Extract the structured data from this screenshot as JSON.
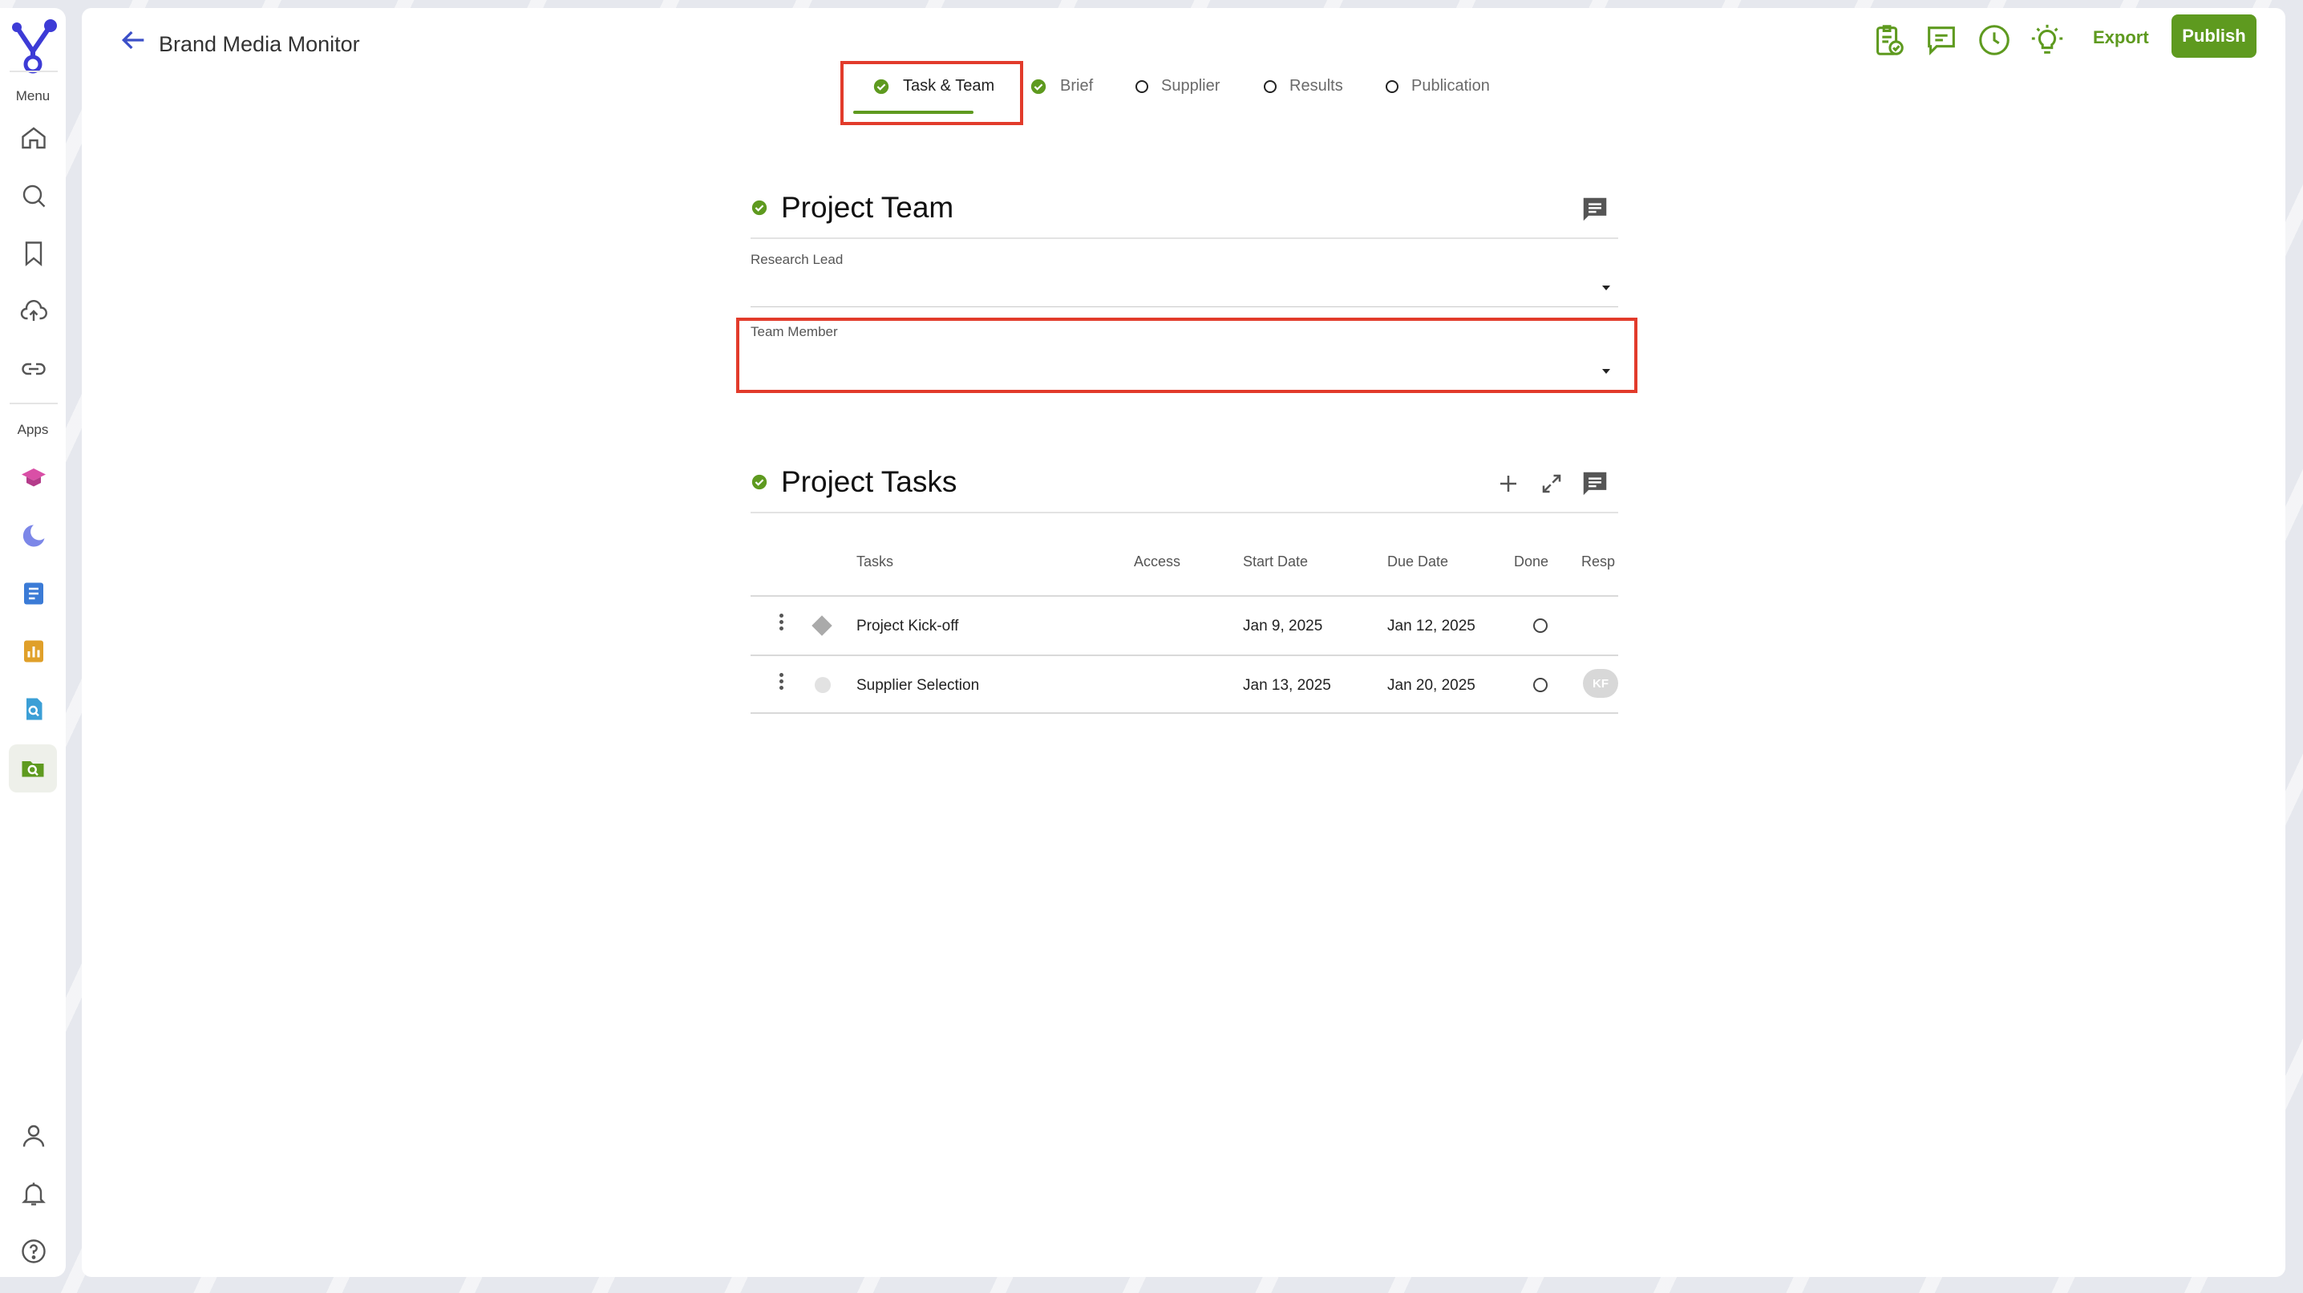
{
  "app": {
    "title": "Brand Media Monitor"
  },
  "sidebar": {
    "menu_label": "Menu",
    "apps_label": "Apps",
    "menu_items": [
      {
        "icon": "home-icon"
      },
      {
        "icon": "search-icon"
      },
      {
        "icon": "bookmark-icon"
      },
      {
        "icon": "upload-cloud-icon"
      },
      {
        "icon": "link-icon"
      }
    ],
    "apps": [
      {
        "icon": "graduation-cap-app-icon",
        "color": "#d94fa6"
      },
      {
        "icon": "moon-app-icon",
        "color": "#7c87e8"
      },
      {
        "icon": "document-list-app-icon",
        "color": "#3b7bd6"
      },
      {
        "icon": "bar-chart-app-icon",
        "color": "#e0a02a"
      },
      {
        "icon": "file-search-app-icon",
        "color": "#3b9fd6"
      },
      {
        "icon": "folder-search-app-icon",
        "color": "#5e9a1f"
      }
    ],
    "bottom_items": [
      {
        "icon": "user-icon"
      },
      {
        "icon": "bell-icon"
      },
      {
        "icon": "help-icon"
      }
    ]
  },
  "header": {
    "export_label": "Export",
    "publish_label": "Publish",
    "accent_color": "#5e9a1f"
  },
  "steps": [
    {
      "label": "Task & Team",
      "status": "done",
      "active": true
    },
    {
      "label": "Brief",
      "status": "done",
      "active": false
    },
    {
      "label": "Supplier",
      "status": "open",
      "active": false
    },
    {
      "label": "Results",
      "status": "open",
      "active": false
    },
    {
      "label": "Publication",
      "status": "open",
      "active": false
    }
  ],
  "project_team": {
    "title": "Project Team",
    "research_lead_label": "Research Lead",
    "research_lead_value": "",
    "team_member_label": "Team Member",
    "team_member_value": ""
  },
  "project_tasks": {
    "title": "Project Tasks",
    "columns": [
      "Tasks",
      "Access",
      "Start Date",
      "Due Date",
      "Done",
      "Resp"
    ],
    "rows": [
      {
        "task": "Project Kick-off",
        "marker": "diamond",
        "access": "",
        "start": "Jan 9, 2025",
        "due": "Jan 12, 2025",
        "done": false,
        "resp": ""
      },
      {
        "task": "Supplier Selection",
        "marker": "dot",
        "access": "",
        "start": "Jan 13, 2025",
        "due": "Jan 20, 2025",
        "done": false,
        "resp": "KF"
      }
    ]
  }
}
